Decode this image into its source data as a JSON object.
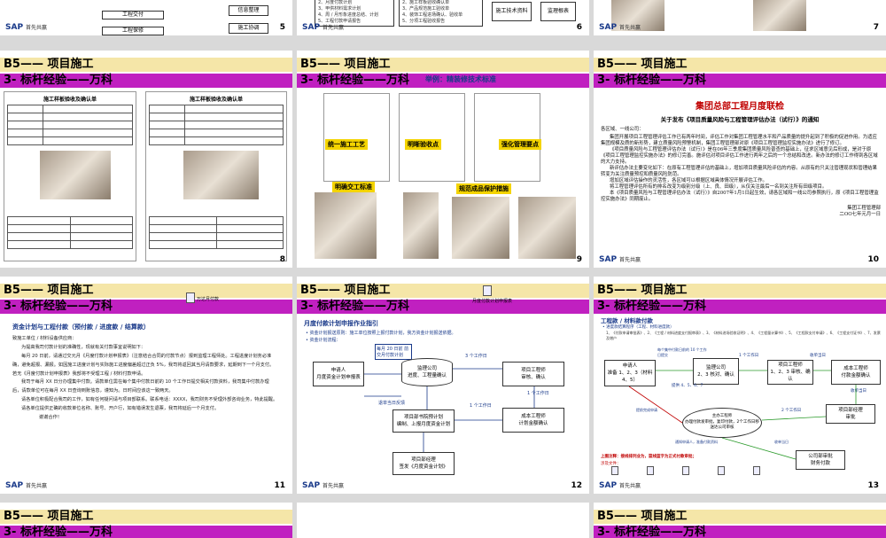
{
  "footer_brand": "SAP",
  "footer_sub": "首先共赢",
  "header1": "B5—— 项目施工",
  "header2": "3- 标杆经验——万科",
  "top_slides": {
    "s5": {
      "num": "5",
      "items": [
        "工程交付",
        "工程保修"
      ],
      "right": [
        "信息整理",
        "施工协调"
      ]
    },
    "s6": {
      "num": "6",
      "list1": [
        "2、月度付款计划",
        "3、甲供材料需求计划",
        "4、周 / 月形象进度总结、计划",
        "5、工程付款申请报告"
      ],
      "list2": [
        "2、施工样板验收确认单",
        "3、产品规范施工验收单",
        "4、装饰工程进场确认、验收单",
        "5、分项工程验收报告"
      ],
      "box1": "施工技术资料",
      "box2": "监理根表"
    },
    "s7": {
      "num": "7"
    }
  },
  "s8": {
    "num": "8",
    "doc_title": "施工样板验收及确认单",
    "doc_title2": "施工样板验收及确认单"
  },
  "s9": {
    "num": "9",
    "subtitle": "举例：精装修技术标准",
    "labels": [
      "统一施工工艺",
      "明晰验收点",
      "强化管理要点",
      "明确交工标准",
      "规范成品保护措施"
    ]
  },
  "s10": {
    "num": "10",
    "title": "集团总部工程月度联检",
    "notice": "关于发布《项目质量风险与工程管理评估办法（试行）》的通知",
    "greeting": "各区域、一线公司：",
    "paras": [
      "集团开展项目工程管理评估工作已有两年时间，评估工作对集团工程管理水平和产品质量的提升起到了积极的促进作用。为适应集团规模及质的新形势，建立质量风险预警机制，集团工程管理部对原《项目工程管理监控实施办法》进行了修订。",
      "《项目质量风险与工程管理评估办法（试行）》是在06年三季度集团质量风险普查的基础上，征求区域意见后形成，是对于原《项目工程管理监控实施办法》的修订完善。施评估对项目评估工作进行两年之后的一个总结和改进。新办法的修订工作得到各区域的大力支持。",
      "新评估办法主要变化如下：在原有工程管理评估的基础上，增加项目质量风险评估的内容。从原有的只关注管理现状和管理结果转变为关注质量预控和质量风险防范。",
      "增加区域评估操作的灵活性，各区域可以根据区域具体情况开展评估工作。",
      "将工程管理评估所有的排名改变为级别分级（上、良、田级），从仅关注最后一名到关注所有田级项目。",
      "本《项目质量风险与工程管理评估办法（试行）》自2007年1月1日起生效，请各区域和一线公司参照执行，原《项目工程管理监控实施办法》同期废止。"
    ],
    "signature": "集团工程管理部",
    "date": "二OO七年元月一日"
  },
  "s11": {
    "num": "11",
    "icon_label": "万达月付款",
    "title": "资金计划与工程付款（预付款 / 进度款 / 结算款）",
    "lines": [
      "致施工单位 / 材料设备供应商：",
      "为提高我司付款计划的准确性，现就有关付款事宜说明如下：",
      "每月 20 日前，请通过交元月《月度付款计划申报表》（注意结合合同的付款节点）报到监理工程师处。工程进度计划务必准确，避免超报、漏报。如因施工进度计划与实际施工进度偏差超过正负 5%，我司将返回其当月请款要求，延期到下一个月支付。若无《月度付款计划申报表》我部将不受理工程 / 材料付款申请。",
      "我司于每月 XX 日分办理集中付款。请款单位需在每个集中付款日前的 10 个工作日提交相关付款资料，我司集中付款办理后，请款单位可在每月 XX 日查询到账信息，谨知为。日时间应该这一致两天。",
      "请各单位积极配合我司的工作，如有任何疑问请与项目部联系。联系电话：XXXX，我司财务不受理外部咨询业务，特此提醒。",
      "请各单位提供正确的收款单位名称、账号、开户行，如有错误发生退票，我司将延后一个月支付。",
      "谢谢合作！"
    ]
  },
  "s12": {
    "num": "12",
    "icon_label": "月度付款计划申报表",
    "title": "月度付款计划申报作业指引",
    "bullets": [
      "资金计划报送原则：施工单位按照上报付款计划，我方资金计划报送依据。",
      "资金计划流程："
    ],
    "callout": "每月 20 日前 前交月付款计划",
    "boxes": {
      "applicant": "申请人\n月度资金计划申报表",
      "supervisor": "监理公司\n进度、工程量确认",
      "pm": "项目工程师\n审核、确认",
      "cost": "成本工程师\n计划金额确认",
      "dept": "项目部书院预计划\n编制、上报月度资金计划",
      "manager": "项目部经理\n签发《月度资金计划》"
    },
    "arrows": [
      "3 个工作日",
      "1 个工作日",
      "1 个工作日",
      "退单当日反馈"
    ]
  },
  "s13": {
    "num": "13",
    "title": "工程款 / 材料款付款",
    "bullets": [
      "进度款结算程序（工程、材料进度款）",
      "1、《付款申请审批表》、2、《工程 / 材料进度支付报审表》、3、《材料进场验收证明》、4、《工程量计算书》、5、《工程款支付申请》、6、《工程支付证书》、7、发票及增户"
    ],
    "boxes": {
      "applicant": "申请人\n准备 1、2、3（材料 4、5）",
      "supervisor": "监理公司\n2、3 核对、确认",
      "pm": "项目工程师\n1、2、3 审核、确认",
      "cost": "成本工程师\n付款金额确认",
      "main": "主办工程师\n办理付款发审批，复印付款，2个工作日移送达公司审核",
      "dept_mgr": "项目部经理\n审批",
      "finance": "公司部审批\n财务付款"
    },
    "callouts": [
      "每个集中付款日前的 10 个工作日提交",
      "1 个工作日",
      "收单当日",
      "提供 4、5、6、7",
      "收单当日",
      "2 个工作日",
      "通知申请人，准备付款资料",
      "提前完成申请",
      "收单当日"
    ],
    "note": "上图注释：接线排列业为，篮线蓝字为正式付款审批；",
    "docs_label": "涉及文件："
  },
  "bottom_slides": [
    "B5—— 项目施工",
    "B5—— 项目施工"
  ]
}
